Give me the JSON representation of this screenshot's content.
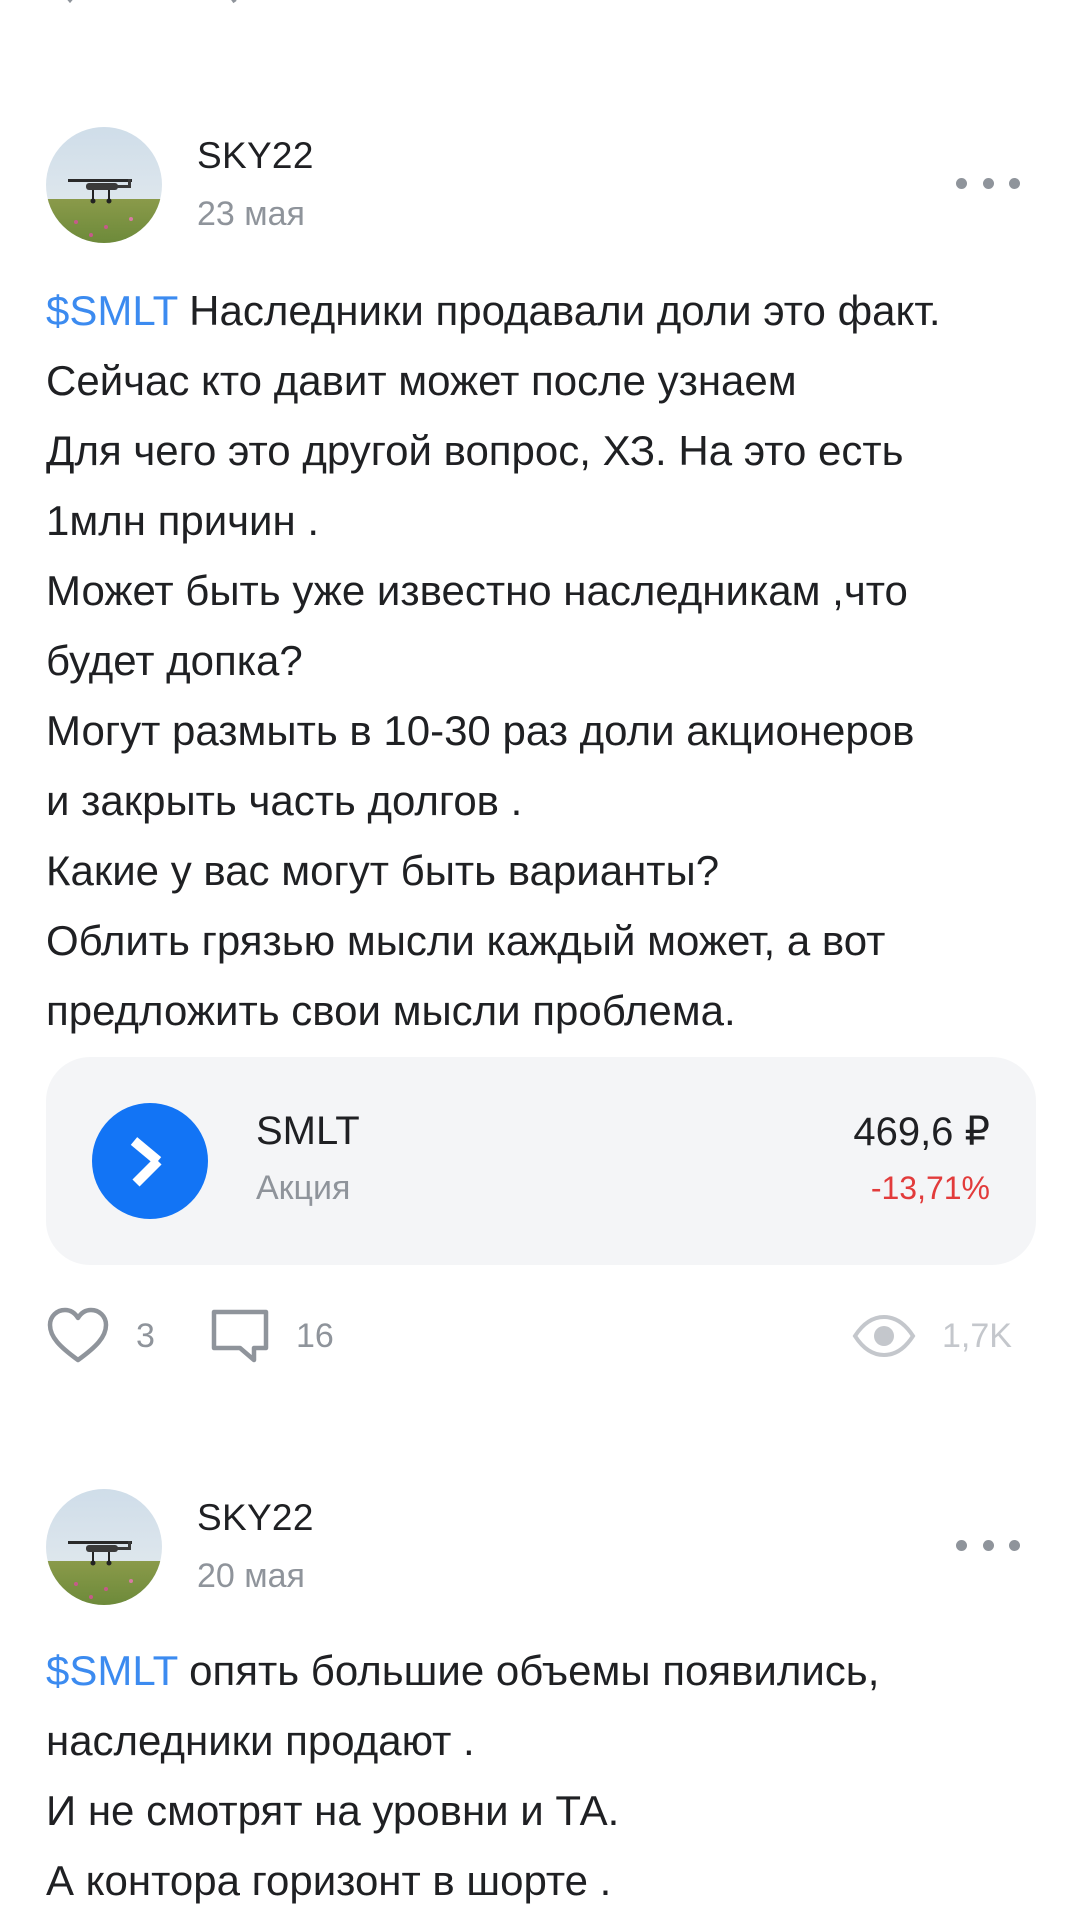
{
  "posts": [
    {
      "author": "SKY22",
      "date": "23 мая",
      "ticker_link": "$SMLT",
      "text_after_ticker": " Наследники продавали доли это факт. Сейчас кто давит может после узнаем",
      "lines": [
        "Для чего это другой вопрос, ХЗ. На это есть",
        "1млн причин .",
        "Может быть уже известно наследникам ,что",
        "будет допка?",
        "Могут размыть в 10-30 раз доли акционеров",
        "и закрыть часть долгов .",
        "Какие у вас могут быть варианты?",
        "Облить грязью мысли каждый может, а вот",
        "предложить свои мысли проблема."
      ],
      "stock": {
        "name": "SMLT",
        "type": "Акция",
        "price": "469,6 ₽",
        "change": "-13,71%"
      },
      "likes": "3",
      "comments": "16",
      "views": "1,7K"
    },
    {
      "author": "SKY22",
      "date": "20 мая",
      "ticker_link": "$SMLT",
      "text_after_ticker": " опять большие  объемы появились,",
      "lines": [
        "наследники продают .",
        "И не смотрят на уровни и ТА.",
        "А контора горизонт в шорте ."
      ]
    }
  ],
  "colors": {
    "link": "#3c8bf0",
    "negative": "#e23b3b",
    "muted": "#8f949b",
    "card_bg": "#f4f5f7",
    "brand_logo": "#1274f5"
  },
  "icons": {
    "more": "more-icon",
    "like": "heart-icon",
    "comment": "comment-icon",
    "views": "eye-icon"
  }
}
